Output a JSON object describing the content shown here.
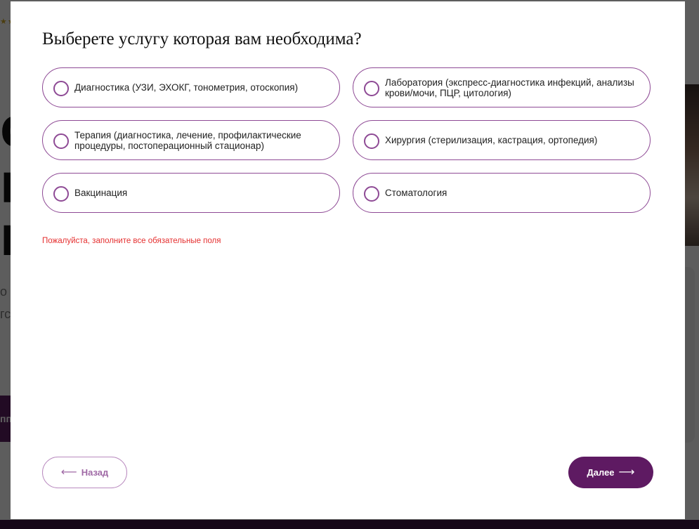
{
  "modal": {
    "title": "Выберете услугу которая вам необходима?",
    "options": [
      {
        "label": "Диагностика (УЗИ, ЭХОКГ, тонометрия, отоскопия)",
        "selected": false
      },
      {
        "label": "Лаборатория (экспресс-диагностика инфекций, анализы крови/мочи, ПЦР, цитология)",
        "selected": false
      },
      {
        "label": "Терапия (диагностика, лечение, профилактические процедуры, постоперационный стационар)",
        "selected": false
      },
      {
        "label": "Хирургия (стерилизация, кастрация, ортопедия)",
        "selected": false
      },
      {
        "label": "Вакцинация",
        "selected": false
      },
      {
        "label": "Стоматология",
        "selected": false
      }
    ],
    "error": "Пожалуйста, заполните все обязательные поля",
    "back_arrow": "⟵",
    "back_label": "Назад",
    "next_label": "Далее",
    "next_arrow": "⟶"
  },
  "background": {
    "stars": "★★",
    "big_letters": [
      "с",
      "п",
      "и"
    ],
    "small_lines": [
      "о -",
      "гс"
    ],
    "button_text": "пп"
  },
  "colors": {
    "accent": "#5e1a62",
    "border": "#8e4a95",
    "error": "#e53030"
  }
}
